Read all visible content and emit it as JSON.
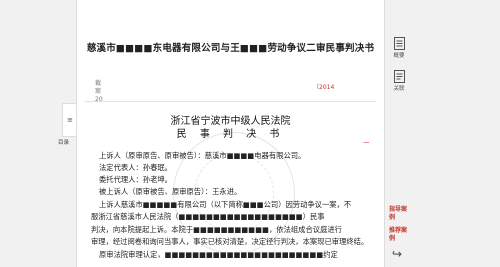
{
  "document": {
    "title": "慈溪市■■■■东电器有限公司与王■■■劳动争议二审民事判决书",
    "meta": [
      {
        "label": "裁",
        "value": ""
      },
      {
        "label": "案",
        "value": ""
      },
      {
        "label": "20",
        "value": "（2014",
        "highlight": true
      }
    ],
    "court_name": "浙江省宁波市中级人民法院",
    "doc_type": "民 事 判 决 书",
    "case_number_mark": "一"
  },
  "paragraphs": [
    "上诉人（原审原告、原审被告）：慈溪市■■■■电器有限公司。",
    "法定代表人：孙春珉。",
    "委托代理人：孙老坤。",
    "被上诉人（原审被告、原审原告）：王永进。",
    "上诉人慈溪市■■■■■有限公司（以下简称■■■公司）因劳动争议一案，不",
    "服浙江省慈溪市人民法院（■■■■■■■■■■■■■■■■■■）民事",
    "判决，向本院提起上诉。本院于■■■■■■■■■■■，依法组成合议庭进行",
    "审理，经过阅卷和询问当事人，事实已核对清楚，决定径行判决，本案现已审理终结。",
    "原审法院审理认定，■■■■■■■■■■■■■■■■■■■■■■■约定"
  ],
  "sidebar_left": {
    "tab_icon": "≡",
    "label": "目录"
  },
  "sidebar_right": {
    "buttons": [
      {
        "label": "概要"
      },
      {
        "label": "关联"
      }
    ],
    "links": [
      "指导案例",
      "推荐案例"
    ],
    "share_icon": "↪"
  }
}
